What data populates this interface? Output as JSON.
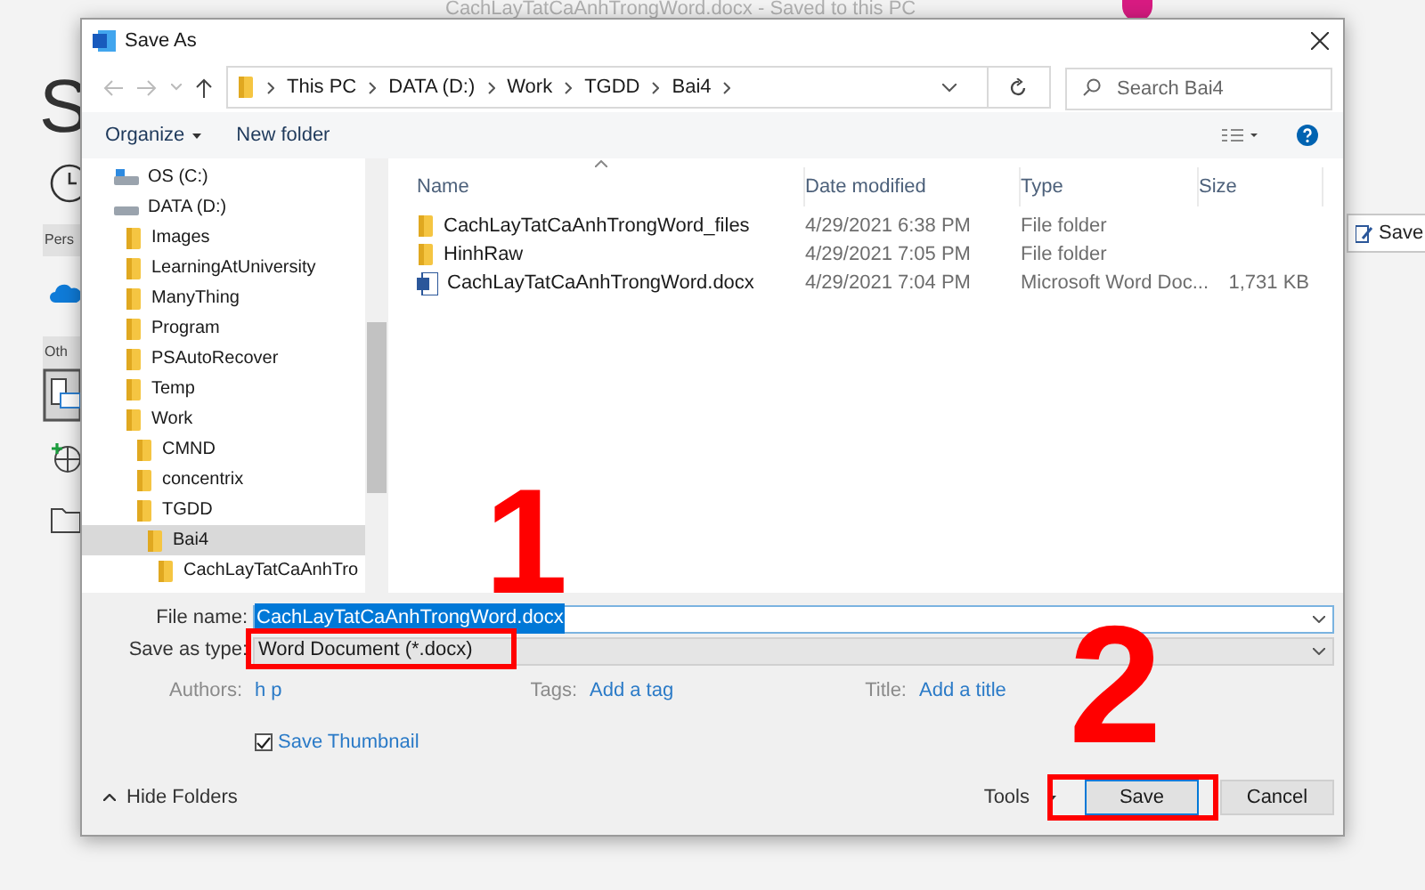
{
  "backstage": {
    "document_title": "CachLayTatCaAnhTrongWord.docx - Saved to this PC",
    "heading": "S",
    "sections": [
      "Pers",
      "Oth"
    ],
    "save_button": "Save"
  },
  "dialog": {
    "title": "Save As",
    "breadcrumb": [
      "This PC",
      "DATA (D:)",
      "Work",
      "TGDD",
      "Bai4"
    ],
    "search": {
      "placeholder": "Search Bai4"
    },
    "toolbar": [
      "Organize",
      "New folder"
    ],
    "nav_tree": [
      {
        "kind": "drive",
        "label": "OS (C:)",
        "selected": false
      },
      {
        "kind": "drive",
        "label": "DATA (D:)",
        "selected": false,
        "children": [
          {
            "kind": "folder",
            "label": "Images",
            "selected": false
          },
          {
            "kind": "folder",
            "label": "LearningAtUniversity",
            "selected": false
          },
          {
            "kind": "folder",
            "label": "ManyThing",
            "selected": false
          },
          {
            "kind": "folder",
            "label": "Program",
            "selected": false
          },
          {
            "kind": "folder",
            "label": "PSAutoRecover",
            "selected": false
          },
          {
            "kind": "folder",
            "label": "Temp",
            "selected": false
          },
          {
            "kind": "folder",
            "label": "Work",
            "selected": false,
            "children": [
              {
                "kind": "folder",
                "label": "CMND",
                "selected": false
              },
              {
                "kind": "folder",
                "label": "concentrix",
                "selected": false
              },
              {
                "kind": "folder",
                "label": "TGDD",
                "selected": false,
                "children": [
                  {
                    "kind": "folder",
                    "label": "Bai4",
                    "selected": true,
                    "children": [
                      {
                        "kind": "folder",
                        "label": "CachLayTatCaAnhTro",
                        "selected": false
                      }
                    ]
                  }
                ]
              }
            ]
          }
        ]
      }
    ],
    "columns": [
      "Name",
      "Date modified",
      "Type",
      "Size"
    ],
    "files": [
      {
        "kind": "folder",
        "name": "CachLayTatCaAnhTrongWord_files",
        "date": "4/29/2021 6:38 PM",
        "type": "File folder"
      },
      {
        "kind": "folder",
        "name": "HinhRaw",
        "date": "4/29/2021 7:05 PM",
        "type": "File folder"
      },
      {
        "kind": "document",
        "name": "CachLayTatCaAnhTrongWord.docx",
        "date": "4/29/2021 7:04 PM",
        "type": "Microsoft Word Doc...",
        "size": "1,731 KB"
      }
    ],
    "file_name": {
      "label": "File name:",
      "value": "CachLayTatCaAnhTrongWord.docx"
    },
    "save_as_type": {
      "label": "Save as type:",
      "value": "Word Document (*.docx)"
    },
    "properties": [
      {
        "label": "Authors:",
        "value": "h p"
      },
      {
        "label": "Tags:",
        "value": "Add a tag"
      },
      {
        "label": "Title:",
        "value": "Add a title"
      }
    ],
    "save_thumbnail": {
      "label": "Save Thumbnail",
      "checked": true
    },
    "hide_folders": "Hide Folders",
    "tools": "Tools",
    "buttons": [
      "Save",
      "Cancel"
    ]
  },
  "annotations": [
    "1",
    "2"
  ]
}
